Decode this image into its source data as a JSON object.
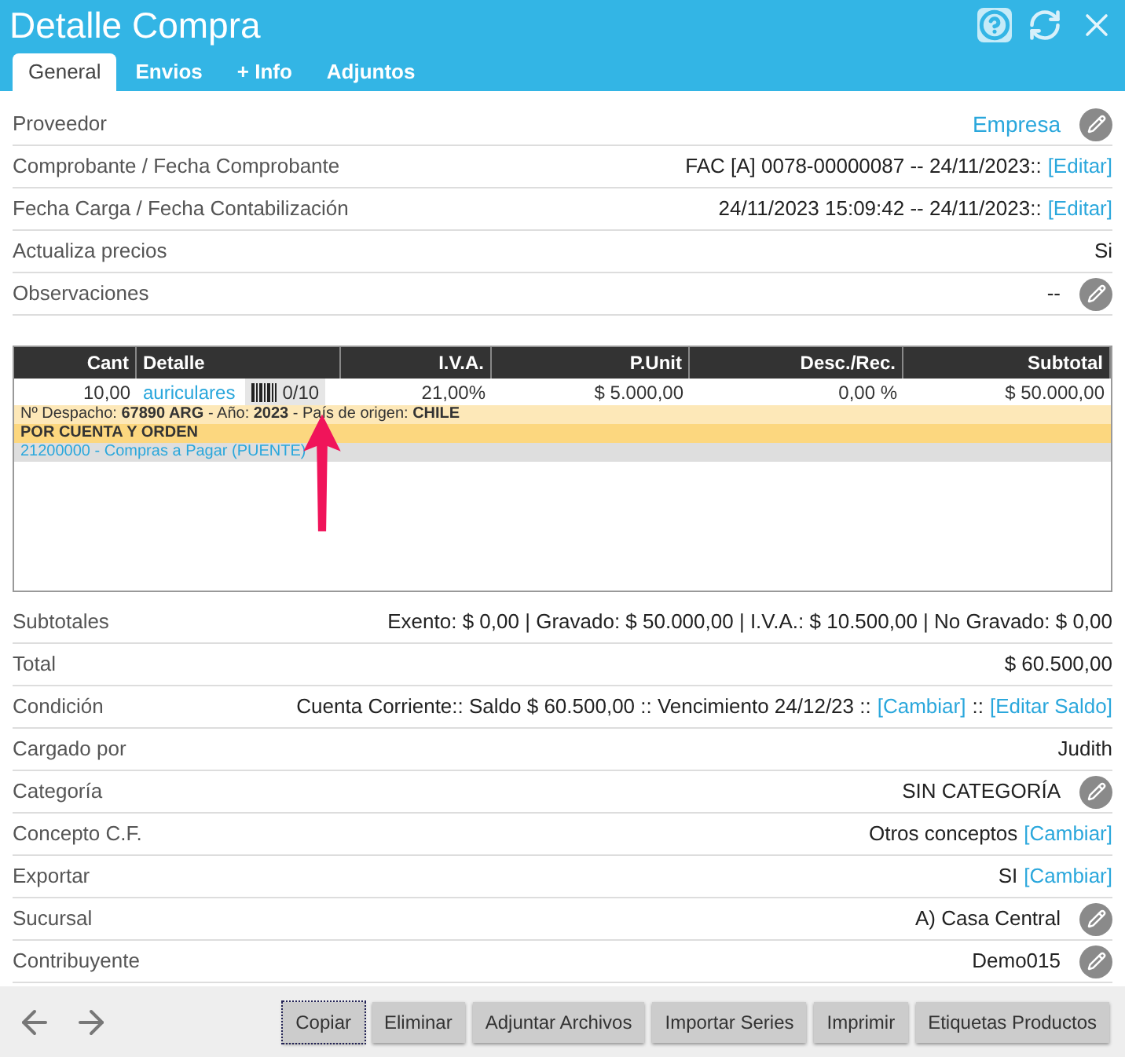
{
  "window": {
    "title": "Detalle Compra"
  },
  "tabs": [
    {
      "label": "General",
      "selected": true
    },
    {
      "label": "Envios",
      "selected": false
    },
    {
      "label": "+ Info",
      "selected": false
    },
    {
      "label": "Adjuntos",
      "selected": false
    }
  ],
  "fields": [
    {
      "label": "Proveedor",
      "parts": [
        {
          "kind": "link",
          "text": "Empresa"
        }
      ],
      "editable": true
    },
    {
      "label": "Comprobante / Fecha Comprobante",
      "parts": [
        {
          "kind": "text",
          "text": "FAC [A] 0078-00000087 -- 24/11/2023::"
        },
        {
          "kind": "link",
          "text": "[Editar]"
        }
      ],
      "editable": false
    },
    {
      "label": "Fecha Carga / Fecha Contabilización",
      "parts": [
        {
          "kind": "text",
          "text": "24/11/2023 15:09:42 -- 24/11/2023::"
        },
        {
          "kind": "link",
          "text": "[Editar]"
        }
      ],
      "editable": false
    },
    {
      "label": "Actualiza precios",
      "parts": [
        {
          "kind": "text",
          "text": "Si"
        }
      ],
      "editable": false
    },
    {
      "label": "Observaciones",
      "parts": [
        {
          "kind": "text",
          "text": "--"
        }
      ],
      "editable": true
    }
  ],
  "items_table": {
    "columns": [
      "Cant",
      "Detalle",
      "I.V.A.",
      "P.Unit",
      "Desc./Rec.",
      "Subtotal"
    ],
    "rows": [
      {
        "cant": "10,00",
        "detalle": "auriculares",
        "series": "0/10",
        "iva": "21,00%",
        "punit": "$ 5.000,00",
        "desc": "0,00 %",
        "subtotal": "$ 50.000,00",
        "dispatch": "Nº Despacho: **67890 ARG** - Año: **2023** - País de origen: **CHILE**",
        "note": "POR CUENTA Y ORDEN",
        "account": "21200000 - Compras a Pagar (PUENTE)"
      }
    ]
  },
  "summary": [
    {
      "label": "Subtotales",
      "parts": [
        {
          "kind": "text",
          "text": "Exento: $ 0,00 | Gravado: $ 50.000,00 | I.V.A.: $ 10.500,00 | No Gravado: $ 0,00"
        }
      ],
      "editable": false
    },
    {
      "label": "Total",
      "parts": [
        {
          "kind": "text",
          "text": "$ 60.500,00"
        }
      ],
      "editable": false
    },
    {
      "label": "Condición",
      "parts": [
        {
          "kind": "text",
          "text": "Cuenta Corriente:: Saldo $ 60.500,00 :: Vencimiento 24/12/23 ::"
        },
        {
          "kind": "link",
          "text": "[Cambiar]"
        },
        {
          "kind": "text",
          "text": "::"
        },
        {
          "kind": "link",
          "text": "[Editar Saldo]"
        }
      ],
      "editable": false
    },
    {
      "label": "Cargado por",
      "parts": [
        {
          "kind": "text",
          "text": "Judith"
        }
      ],
      "editable": false
    },
    {
      "label": "Categoría",
      "parts": [
        {
          "kind": "text",
          "text": "SIN CATEGORÍA"
        }
      ],
      "editable": true
    },
    {
      "label": "Concepto C.F.",
      "parts": [
        {
          "kind": "text",
          "text": "Otros conceptos"
        },
        {
          "kind": "link",
          "text": "[Cambiar]"
        }
      ],
      "editable": false
    },
    {
      "label": "Exportar",
      "parts": [
        {
          "kind": "text",
          "text": "SI"
        },
        {
          "kind": "link",
          "text": "[Cambiar]"
        }
      ],
      "editable": false
    },
    {
      "label": "Sucursal",
      "parts": [
        {
          "kind": "text",
          "text": "A) Casa Central"
        }
      ],
      "editable": true
    },
    {
      "label": "Contribuyente",
      "parts": [
        {
          "kind": "text",
          "text": "Demo015"
        }
      ],
      "editable": true
    }
  ],
  "buttons": [
    {
      "label": "Copiar",
      "selected": true
    },
    {
      "label": "Eliminar",
      "selected": false
    },
    {
      "label": "Adjuntar Archivos",
      "selected": false
    },
    {
      "label": "Importar Series",
      "selected": false
    },
    {
      "label": "Imprimir",
      "selected": false
    },
    {
      "label": "Etiquetas Productos",
      "selected": false
    }
  ]
}
